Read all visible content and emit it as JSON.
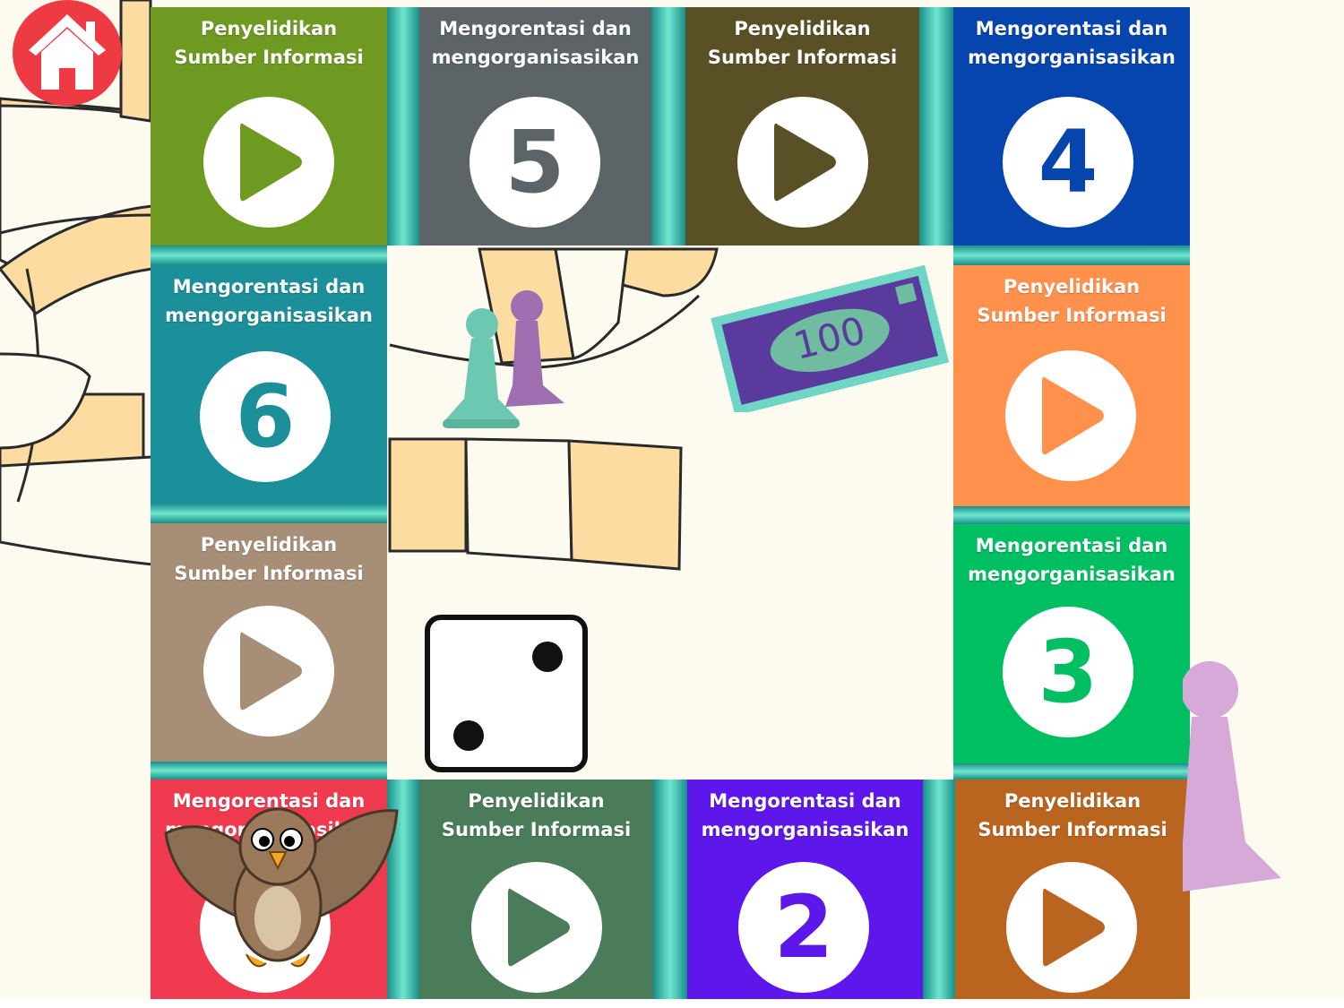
{
  "colors": {
    "background": "#fdfaf0",
    "connector": "#3cc7b0",
    "home_button": "#ee3a43",
    "path_tile": "#fcdca0"
  },
  "home_button": {
    "icon": "home-icon"
  },
  "dice": {
    "face_value": 2
  },
  "money_note": {
    "label": "100",
    "color": "#5b3a9e"
  },
  "tiles": [
    {
      "label": "Penyelidikan\nSumber Informasi",
      "content": "play",
      "color": "#6f9a22"
    },
    {
      "label": "Mengorentasi dan\nmengorganisasikan",
      "content": "5",
      "color": "#5c6468"
    },
    {
      "label": "Penyelidikan\nSumber Informasi",
      "content": "play",
      "color": "#5a5026"
    },
    {
      "label": "Mengorentasi dan\nmengorganisasikan",
      "content": "4",
      "color": "#0545ad"
    },
    {
      "label": "Mengorentasi dan\nmengorganisasikan",
      "content": "6",
      "color": "#1b8f9a"
    },
    {
      "label": "Penyelidikan\nSumber Informasi",
      "content": "play",
      "color": "#ff914d"
    },
    {
      "label": "Penyelidikan\nSumber Informasi",
      "content": "play",
      "color": "#a68e77"
    },
    {
      "label": "Mengorentasi dan\nmengorganisasikan",
      "content": "3",
      "color": "#00bf63"
    },
    {
      "label": "Mengorentasi dan\nmengorganisasikan",
      "content": "",
      "color": "#f03a4f"
    },
    {
      "label": "Penyelidikan\nSumber Informasi",
      "content": "play",
      "color": "#4a7c59"
    },
    {
      "label": "Mengorentasi dan\nmengorganisasikan",
      "content": "2",
      "color": "#5e17eb"
    },
    {
      "label": "Penyelidikan\nSumber Informasi",
      "content": "play",
      "color": "#b9651f"
    }
  ]
}
